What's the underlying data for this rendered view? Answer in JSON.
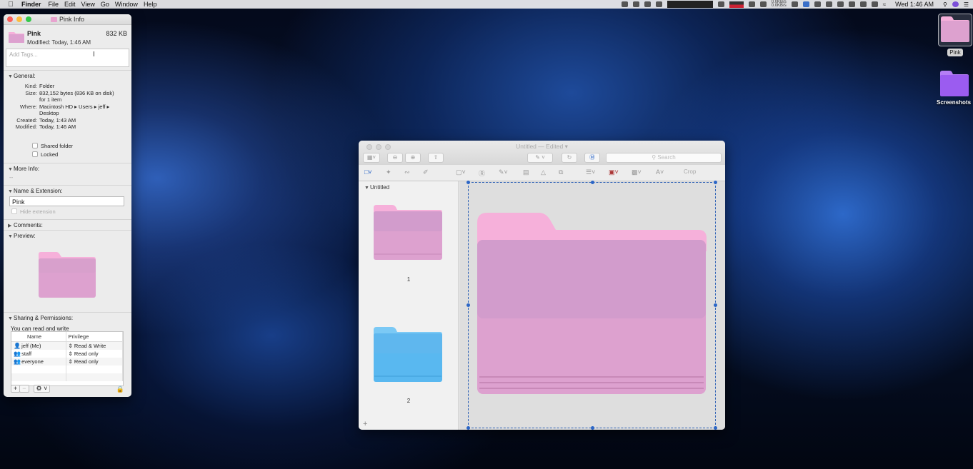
{
  "menubar": {
    "app": "Finder",
    "items": [
      "File",
      "Edit",
      "View",
      "Go",
      "Window",
      "Help"
    ],
    "clock": "Wed 1:46 AM",
    "net_up": "0.0KB/s",
    "net_down": "0.0KB/s"
  },
  "info_window": {
    "title": "Pink Info",
    "name": "Pink",
    "size": "832 KB",
    "modified_line": "Modified: Today, 1:46 AM",
    "tags_placeholder": "Add Tags...",
    "general": {
      "header": "General:",
      "kind_label": "Kind:",
      "kind": "Folder",
      "size_label": "Size:",
      "size": "832,152 bytes (836 KB on disk)",
      "size2": "for 1 item",
      "where_label": "Where:",
      "where": "Macintosh HD ▸ Users ▸ jeff ▸",
      "where2": "Desktop",
      "created_label": "Created:",
      "created": "Today, 1:43 AM",
      "modified_label": "Modified:",
      "modified": "Today, 1:46 AM",
      "shared": "Shared folder",
      "locked": "Locked"
    },
    "more_info": {
      "header": "More Info:",
      "value": "--"
    },
    "name_ext": {
      "header": "Name & Extension:",
      "value": "Pink",
      "hide": "Hide extension"
    },
    "comments": {
      "header": "Comments:"
    },
    "preview": {
      "header": "Preview:"
    },
    "sharing": {
      "header": "Sharing & Permissions:",
      "summary": "You can read and write",
      "col_name": "Name",
      "col_priv": "Privilege",
      "rows": [
        {
          "name": "jeff (Me)",
          "priv": "Read & Write"
        },
        {
          "name": "staff",
          "priv": "Read only"
        },
        {
          "name": "everyone",
          "priv": "Read only"
        }
      ]
    }
  },
  "preview_window": {
    "title": "Untitled",
    "edited": "— Edited ▾",
    "search_placeholder": "Search",
    "crop": "Crop",
    "sidebar_header": "Untitled",
    "pages": [
      "1",
      "2"
    ]
  },
  "desktop": {
    "icons": [
      {
        "label": "Pink"
      },
      {
        "label": "Screenshots"
      }
    ]
  },
  "colors": {
    "pink_folder": "#e6a6d1",
    "pink_tab": "#f6b0da",
    "blue_folder": "#59b8f0",
    "purple_folder": "#9b5cf0",
    "accent": "#2b66c7"
  }
}
